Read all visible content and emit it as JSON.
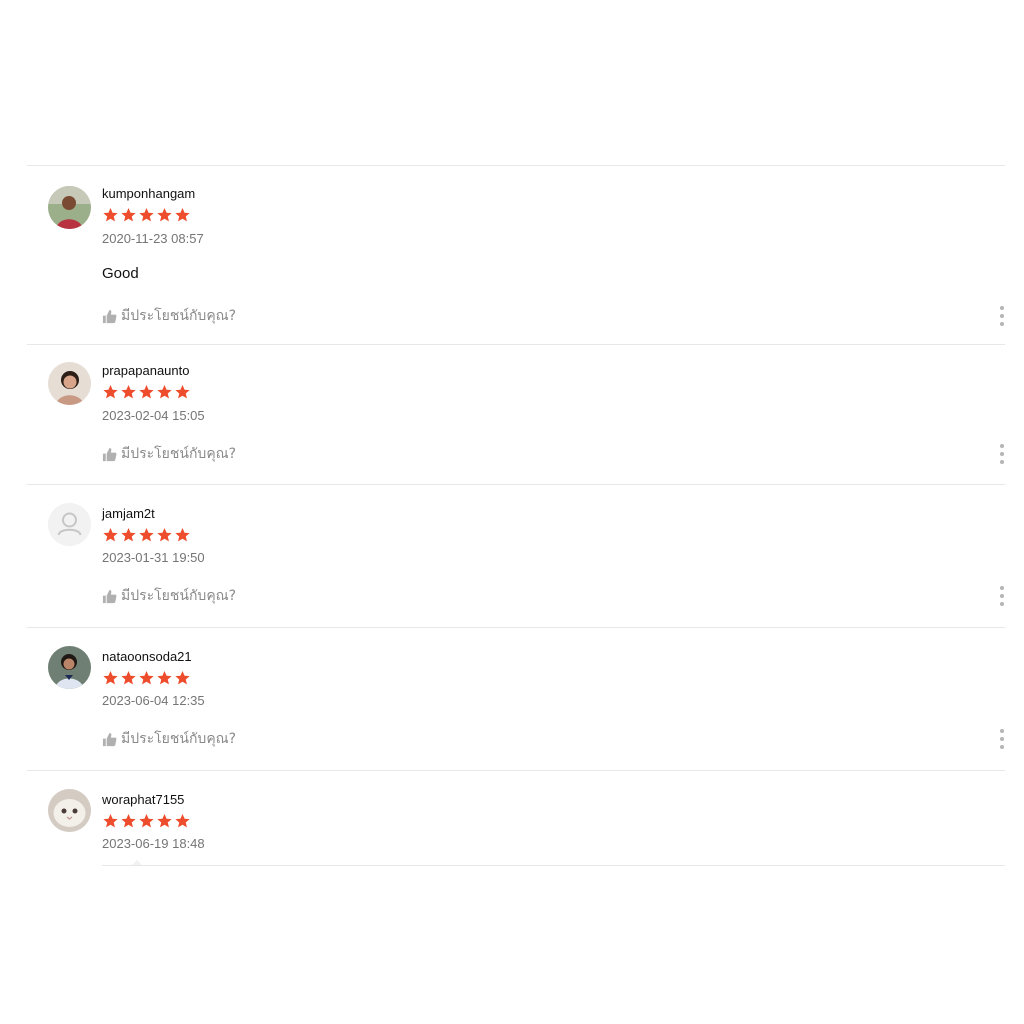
{
  "rating_color": "#ee4d2d",
  "helpful_label": "มีประโยชน์กับคุณ?",
  "reviews": [
    {
      "username": "kumponhangam",
      "stars": 5,
      "date": "2020-11-23 08:57",
      "comment": "Good",
      "avatar": "photo-man"
    },
    {
      "username": "prapapanaunto",
      "stars": 5,
      "date": "2023-02-04 15:05",
      "comment": "",
      "avatar": "photo-woman"
    },
    {
      "username": "jamjam2t",
      "stars": 5,
      "date": "2023-01-31 19:50",
      "comment": "",
      "avatar": "default-user-icon"
    },
    {
      "username": "nataoonsoda21",
      "stars": 5,
      "date": "2023-06-04 12:35",
      "comment": "",
      "avatar": "photo-student"
    },
    {
      "username": "woraphat7155",
      "stars": 5,
      "date": "2023-06-19 18:48",
      "comment": "",
      "avatar": "photo-cat"
    }
  ]
}
